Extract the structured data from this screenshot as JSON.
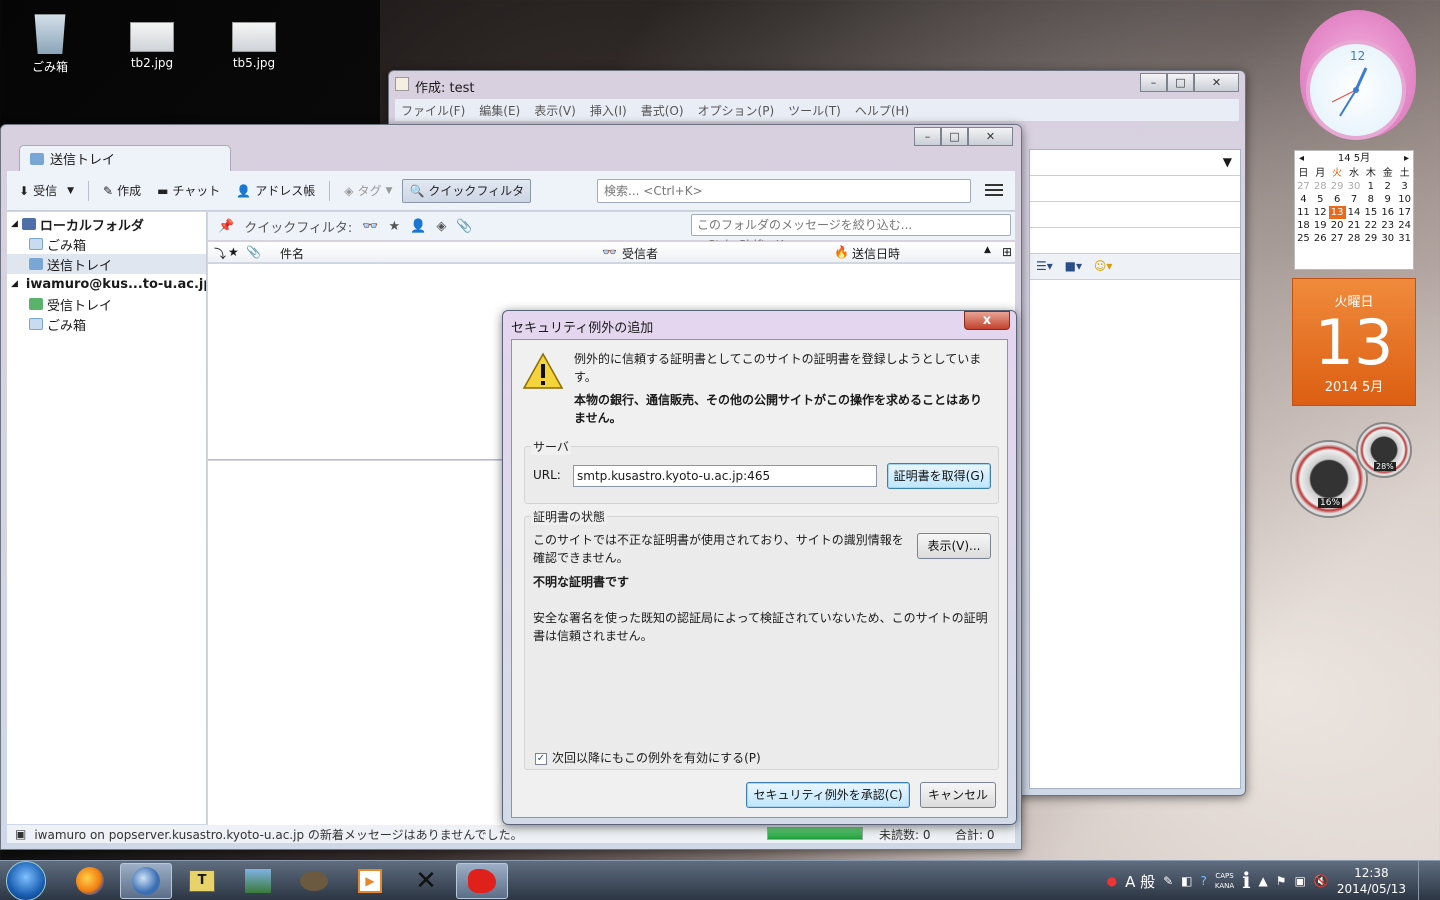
{
  "desktop": {
    "icons": [
      {
        "label": "ごみ箱"
      },
      {
        "label": "tb2.jpg"
      },
      {
        "label": "tb5.jpg"
      }
    ]
  },
  "compose": {
    "title": "作成: test",
    "menu": [
      "ファイル(F)",
      "編集(E)",
      "表示(V)",
      "挿入(I)",
      "書式(O)",
      "オプション(P)",
      "ツール(T)",
      "ヘルプ(H)"
    ]
  },
  "thunderbird": {
    "tab_label": "送信トレイ",
    "toolbar": {
      "get_mail": "受信",
      "write": "作成",
      "chat": "チャット",
      "address_book": "アドレス帳",
      "tag": "タグ",
      "quick_filter": "クイックフィルタ"
    },
    "search_placeholder": "検索... <Ctrl+K>",
    "folders": [
      {
        "label": "ローカルフォルダ",
        "level": 0,
        "bold": true
      },
      {
        "label": "ごみ箱",
        "level": 1
      },
      {
        "label": "送信トレイ",
        "level": 1,
        "selected": true
      },
      {
        "label": "iwamuro@kus...to-u.ac.jp",
        "level": 0,
        "bold": true
      },
      {
        "label": "受信トレイ",
        "level": 1
      },
      {
        "label": "ごみ箱",
        "level": 1
      }
    ],
    "quickfilter_label": "クイックフィルタ:",
    "quickfilter_placeholder": "このフォルダのメッセージを絞り込む... <Ctrl+Shift+K>",
    "columns": {
      "subject": "件名",
      "recipient": "受信者",
      "date": "送信日時"
    },
    "status": {
      "message": "iwamuro on popserver.kusastro.kyoto-u.ac.jp の新着メッセージはありませんでした。",
      "unread": "未読数: 0",
      "total": "合計: 0"
    }
  },
  "dialog": {
    "title": "セキュリティ例外の追加",
    "close": "x",
    "message1": "例外的に信頼する証明書としてこのサイトの証明書を登録しようとしています。",
    "message2": "本物の銀行、通信販売、その他の公開サイトがこの操作を求めることはありません。",
    "server_group": "サーバ",
    "url_label": "URL:",
    "url_value": "smtp.kusastro.kyoto-u.ac.jp:465",
    "get_cert_button": "証明書を取得(G)",
    "cert_status_group": "証明書の状態",
    "cert_status_text": "このサイトでは不正な証明書が使用されており、サイトの識別情報を確認できません。",
    "view_button": "表示(V)...",
    "unknown_cert": "不明な証明書です",
    "unknown_cert_detail": "安全な署名を使った既知の認証局によって検証されていないため、このサイトの証明書は信頼されません。",
    "permanent_checkbox": "次回以降にもこの例外を有効にする(P)",
    "permanent_checked": true,
    "confirm_button": "セキュリティ例外を承認(C)",
    "cancel_button": "キャンセル"
  },
  "gadgets": {
    "calendar": {
      "month_header": "14 5月",
      "weekdays": [
        "日",
        "月",
        "火",
        "水",
        "木",
        "金",
        "土"
      ],
      "weeks": [
        [
          "27",
          "28",
          "29",
          "30",
          "1",
          "2",
          "3"
        ],
        [
          "4",
          "5",
          "6",
          "7",
          "8",
          "9",
          "10"
        ],
        [
          "11",
          "12",
          "13",
          "14",
          "15",
          "16",
          "17"
        ],
        [
          "18",
          "19",
          "20",
          "21",
          "22",
          "23",
          "24"
        ],
        [
          "25",
          "26",
          "27",
          "28",
          "29",
          "30",
          "31"
        ]
      ],
      "today_weekday": "火曜日",
      "today_day": "13",
      "today_month": "2014 5月"
    },
    "meter": {
      "cpu": "16%",
      "memory": "28%"
    }
  },
  "taskbar": {
    "tray_ime": "A 般",
    "caps": "CAPS",
    "kana": "KANA",
    "time": "12:38",
    "date": "2014/05/13"
  }
}
